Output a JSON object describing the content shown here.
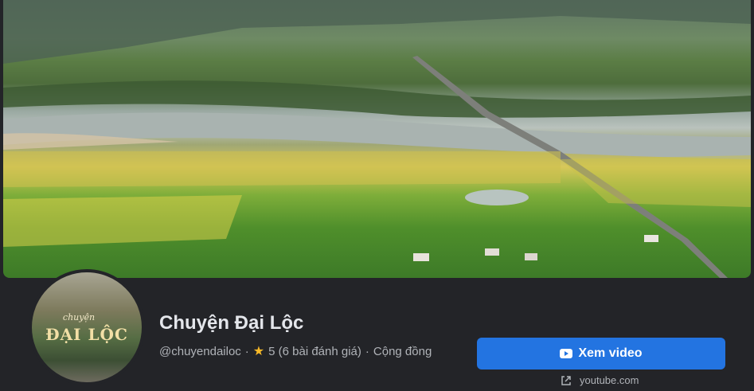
{
  "cover": {
    "icon": "cover-photo"
  },
  "avatar": {
    "line1": "chuyện",
    "line2": "ĐẠI LỘC"
  },
  "page": {
    "name": "Chuyện Đại Lộc",
    "handle": "@chuyendailoc",
    "sep1": "·",
    "rating": "5 (6 bài đánh giá)",
    "sep2": "·",
    "category": "Cộng đồng"
  },
  "cta": {
    "label": "Xem video",
    "icon": "youtube-icon"
  },
  "link": {
    "text": "youtube.com",
    "icon": "external-link-icon"
  },
  "colors": {
    "button": "#2374e1",
    "background": "#232428",
    "star": "#f7b928"
  }
}
